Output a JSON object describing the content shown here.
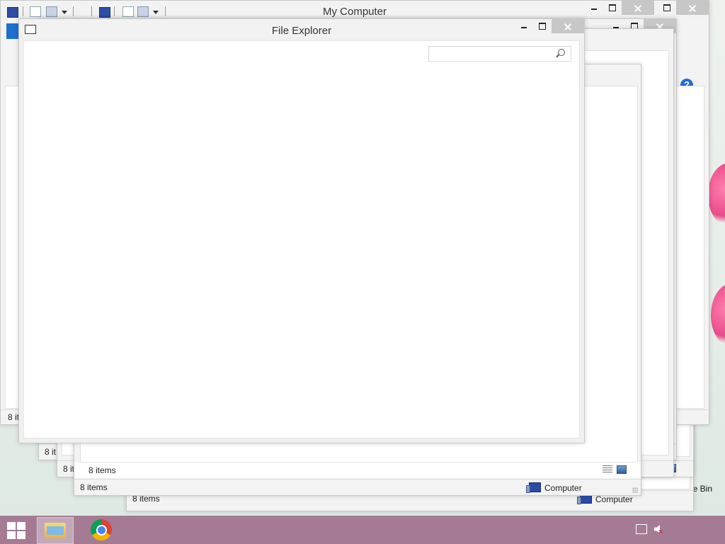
{
  "desktop": {
    "recycle_label": "le Bin"
  },
  "windows": {
    "my_computer": {
      "title": "My Computer",
      "status_count": "8 it"
    },
    "back2": {
      "status_count": "8 it"
    },
    "back3": {
      "status_count": "8 it",
      "status_partial": "8"
    },
    "back4": {
      "status_count": "8 items",
      "location_label": "Computer"
    },
    "back5": {
      "status_count": "8 items",
      "location_label": "Computer",
      "location_partial": "puter"
    },
    "back6": {
      "status_count": "8 items"
    },
    "file_explorer": {
      "title": "File Explorer",
      "search_placeholder": ""
    }
  },
  "taskbar": {
    "items": [
      "start-button",
      "file-explorer",
      "google-chrome"
    ],
    "tray": [
      "network-icon",
      "volume-muted-icon"
    ]
  },
  "colors": {
    "taskbar": "#a57b94",
    "close_button": "#c7c7c7",
    "accent_blue": "#1e6fd0"
  }
}
